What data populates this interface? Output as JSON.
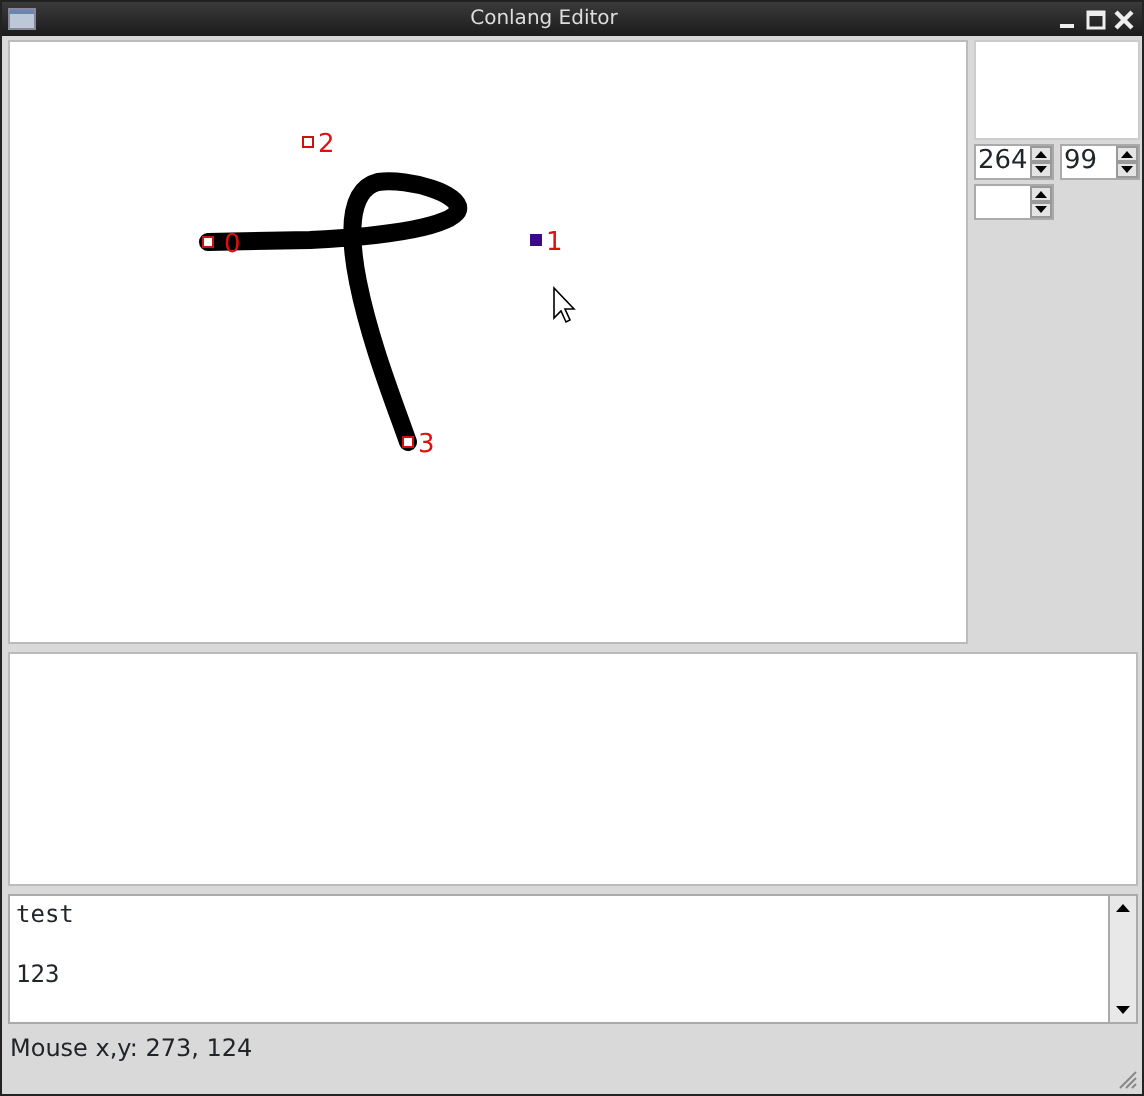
{
  "window": {
    "title": "Conlang Editor"
  },
  "canvas": {
    "points": [
      {
        "label": "0",
        "selected": false
      },
      {
        "label": "1",
        "selected": true
      },
      {
        "label": "2",
        "selected": false
      },
      {
        "label": "3",
        "selected": false
      }
    ]
  },
  "side_panel": {
    "spinners": [
      {
        "value": "264"
      },
      {
        "value": "99"
      }
    ]
  },
  "text_area": {
    "text": "test\n\n123"
  },
  "status_bar": "Mouse x,y: 273, 124"
}
